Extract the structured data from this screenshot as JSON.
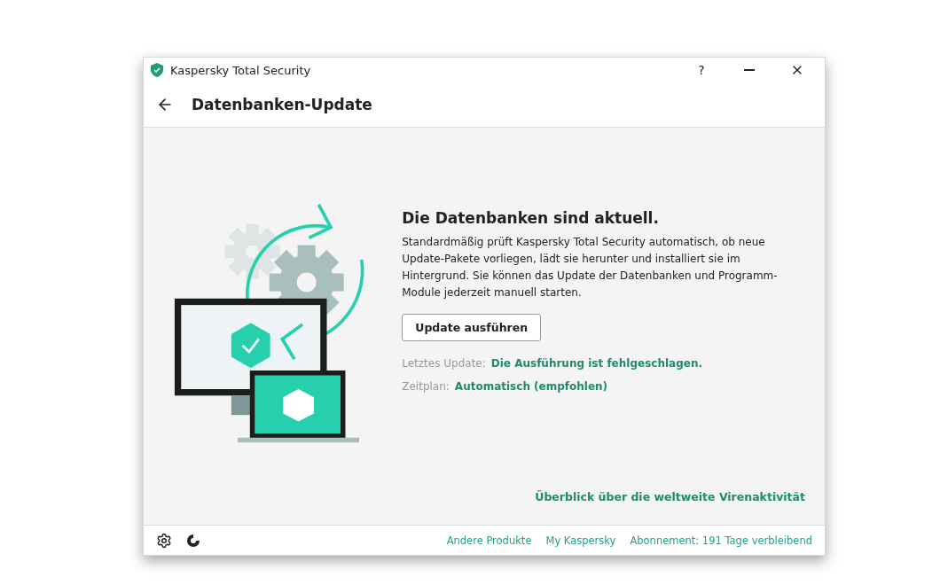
{
  "window": {
    "title": "Kaspersky Total Security",
    "controls": [
      "?"
    ]
  },
  "header": {
    "title": "Datenbanken-Update"
  },
  "status": {
    "heading": "Die Datenbanken sind aktuell.",
    "description": "Standardmäßig prüft Kaspersky Total Security automatisch, ob neue Update-Pakete vorliegen, lädt sie herunter und installiert sie im Hintergrund. Sie können das Update der Datenbanken und Programm-Module jederzeit manuell starten.",
    "button": "Update ausführen",
    "details": [
      {
        "label": "Letztes Update:",
        "value": "Die Ausführung ist fehlgeschlagen."
      },
      {
        "label": "Zeitplan:",
        "value": "Automatisch (empfohlen)"
      }
    ]
  },
  "overview_link": "Überblick über die weltweite Virenaktivität",
  "footer": {
    "links": [
      "Andere Produkte",
      "My Kaspersky",
      "Abonnement: 191 Tage verbleibend"
    ]
  }
}
